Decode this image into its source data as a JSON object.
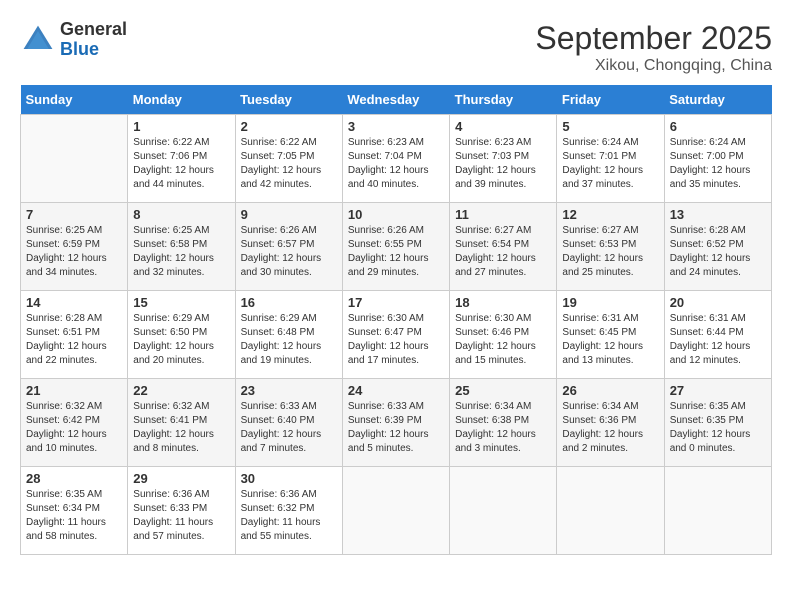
{
  "header": {
    "logo_line1": "General",
    "logo_line2": "Blue",
    "month": "September 2025",
    "location": "Xikou, Chongqing, China"
  },
  "days_of_week": [
    "Sunday",
    "Monday",
    "Tuesday",
    "Wednesday",
    "Thursday",
    "Friday",
    "Saturday"
  ],
  "weeks": [
    [
      {
        "day": "",
        "info": ""
      },
      {
        "day": "1",
        "info": "Sunrise: 6:22 AM\nSunset: 7:06 PM\nDaylight: 12 hours\nand 44 minutes."
      },
      {
        "day": "2",
        "info": "Sunrise: 6:22 AM\nSunset: 7:05 PM\nDaylight: 12 hours\nand 42 minutes."
      },
      {
        "day": "3",
        "info": "Sunrise: 6:23 AM\nSunset: 7:04 PM\nDaylight: 12 hours\nand 40 minutes."
      },
      {
        "day": "4",
        "info": "Sunrise: 6:23 AM\nSunset: 7:03 PM\nDaylight: 12 hours\nand 39 minutes."
      },
      {
        "day": "5",
        "info": "Sunrise: 6:24 AM\nSunset: 7:01 PM\nDaylight: 12 hours\nand 37 minutes."
      },
      {
        "day": "6",
        "info": "Sunrise: 6:24 AM\nSunset: 7:00 PM\nDaylight: 12 hours\nand 35 minutes."
      }
    ],
    [
      {
        "day": "7",
        "info": "Sunrise: 6:25 AM\nSunset: 6:59 PM\nDaylight: 12 hours\nand 34 minutes."
      },
      {
        "day": "8",
        "info": "Sunrise: 6:25 AM\nSunset: 6:58 PM\nDaylight: 12 hours\nand 32 minutes."
      },
      {
        "day": "9",
        "info": "Sunrise: 6:26 AM\nSunset: 6:57 PM\nDaylight: 12 hours\nand 30 minutes."
      },
      {
        "day": "10",
        "info": "Sunrise: 6:26 AM\nSunset: 6:55 PM\nDaylight: 12 hours\nand 29 minutes."
      },
      {
        "day": "11",
        "info": "Sunrise: 6:27 AM\nSunset: 6:54 PM\nDaylight: 12 hours\nand 27 minutes."
      },
      {
        "day": "12",
        "info": "Sunrise: 6:27 AM\nSunset: 6:53 PM\nDaylight: 12 hours\nand 25 minutes."
      },
      {
        "day": "13",
        "info": "Sunrise: 6:28 AM\nSunset: 6:52 PM\nDaylight: 12 hours\nand 24 minutes."
      }
    ],
    [
      {
        "day": "14",
        "info": "Sunrise: 6:28 AM\nSunset: 6:51 PM\nDaylight: 12 hours\nand 22 minutes."
      },
      {
        "day": "15",
        "info": "Sunrise: 6:29 AM\nSunset: 6:50 PM\nDaylight: 12 hours\nand 20 minutes."
      },
      {
        "day": "16",
        "info": "Sunrise: 6:29 AM\nSunset: 6:48 PM\nDaylight: 12 hours\nand 19 minutes."
      },
      {
        "day": "17",
        "info": "Sunrise: 6:30 AM\nSunset: 6:47 PM\nDaylight: 12 hours\nand 17 minutes."
      },
      {
        "day": "18",
        "info": "Sunrise: 6:30 AM\nSunset: 6:46 PM\nDaylight: 12 hours\nand 15 minutes."
      },
      {
        "day": "19",
        "info": "Sunrise: 6:31 AM\nSunset: 6:45 PM\nDaylight: 12 hours\nand 13 minutes."
      },
      {
        "day": "20",
        "info": "Sunrise: 6:31 AM\nSunset: 6:44 PM\nDaylight: 12 hours\nand 12 minutes."
      }
    ],
    [
      {
        "day": "21",
        "info": "Sunrise: 6:32 AM\nSunset: 6:42 PM\nDaylight: 12 hours\nand 10 minutes."
      },
      {
        "day": "22",
        "info": "Sunrise: 6:32 AM\nSunset: 6:41 PM\nDaylight: 12 hours\nand 8 minutes."
      },
      {
        "day": "23",
        "info": "Sunrise: 6:33 AM\nSunset: 6:40 PM\nDaylight: 12 hours\nand 7 minutes."
      },
      {
        "day": "24",
        "info": "Sunrise: 6:33 AM\nSunset: 6:39 PM\nDaylight: 12 hours\nand 5 minutes."
      },
      {
        "day": "25",
        "info": "Sunrise: 6:34 AM\nSunset: 6:38 PM\nDaylight: 12 hours\nand 3 minutes."
      },
      {
        "day": "26",
        "info": "Sunrise: 6:34 AM\nSunset: 6:36 PM\nDaylight: 12 hours\nand 2 minutes."
      },
      {
        "day": "27",
        "info": "Sunrise: 6:35 AM\nSunset: 6:35 PM\nDaylight: 12 hours\nand 0 minutes."
      }
    ],
    [
      {
        "day": "28",
        "info": "Sunrise: 6:35 AM\nSunset: 6:34 PM\nDaylight: 11 hours\nand 58 minutes."
      },
      {
        "day": "29",
        "info": "Sunrise: 6:36 AM\nSunset: 6:33 PM\nDaylight: 11 hours\nand 57 minutes."
      },
      {
        "day": "30",
        "info": "Sunrise: 6:36 AM\nSunset: 6:32 PM\nDaylight: 11 hours\nand 55 minutes."
      },
      {
        "day": "",
        "info": ""
      },
      {
        "day": "",
        "info": ""
      },
      {
        "day": "",
        "info": ""
      },
      {
        "day": "",
        "info": ""
      }
    ]
  ]
}
